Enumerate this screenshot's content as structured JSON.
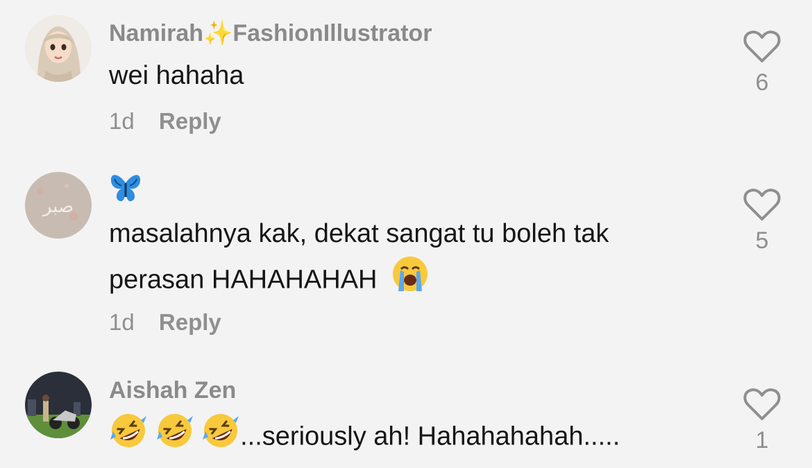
{
  "comments": [
    {
      "username": "Namirah✨FashionIllustrator",
      "text": "wei hahaha",
      "time": "1d",
      "reply_label": "Reply",
      "likes": "6"
    },
    {
      "username": "🦋",
      "text_line1": "masalahnya kak, dekat sangat tu boleh tak",
      "text_line2": "perasan HAHAHAHAH",
      "time": "1d",
      "reply_label": "Reply",
      "likes": "5",
      "avatar_text": "صبر"
    },
    {
      "username": "Aishah Zen",
      "text": "...seriously ah! Hahahahahah.....",
      "likes": "1"
    }
  ],
  "icons": [
    "heart-outline-icon",
    "loudly-crying-face-emoji",
    "rolling-on-floor-laughing-emoji"
  ],
  "colors": {
    "background": "#f3f3f3",
    "text": "#161616",
    "muted": "#8a8a8a"
  }
}
